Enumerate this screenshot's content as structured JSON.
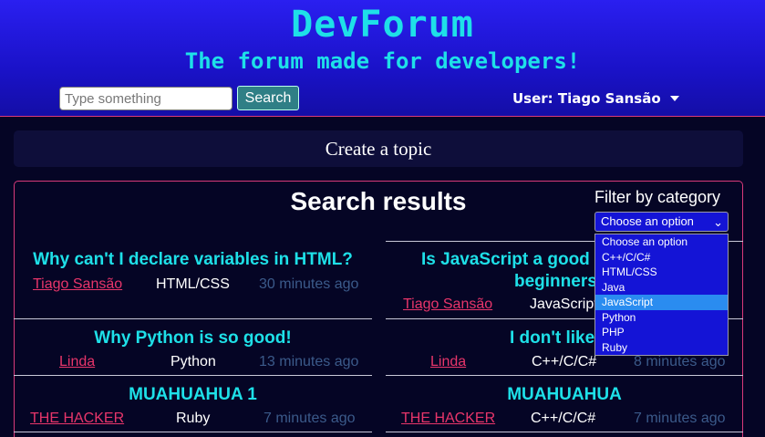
{
  "header": {
    "title": "DevForum",
    "subtitle": "The forum made for developers!",
    "search_placeholder": "Type something",
    "search_label": "Search",
    "user_label": "User: Tiago Sansão"
  },
  "create_topic_label": "Create a topic",
  "results": {
    "title": "Search results",
    "filter_label": "Filter by category",
    "filter_selected": "Choose an option",
    "filter_options": [
      "Choose an option",
      "C++/C/C#",
      "HTML/CSS",
      "Java",
      "JavaScript",
      "Python",
      "PHP",
      "Ruby"
    ],
    "filter_highlighted": "JavaScript"
  },
  "topics": [
    {
      "title": "Why can't I declare variables in HTML?",
      "author": "Tiago Sansão",
      "category": "HTML/CSS",
      "time": "30 minutes ago"
    },
    {
      "title": "Is JavaScript a good",
      "title2": "beginners",
      "author": "Tiago Sansão",
      "category": "JavaScript"
    },
    {
      "title": "Why Python is so good!",
      "author": "Linda",
      "category": "Python",
      "time": "13 minutes ago"
    },
    {
      "title": "I don't like",
      "author": "Linda",
      "category": "C++/C/C#",
      "time": "8 minutes ago"
    },
    {
      "title": "MUAHUAHUA 1",
      "author": "THE HACKER",
      "category": "Ruby",
      "time": "7 minutes ago"
    },
    {
      "title": "MUAHUAHUA",
      "author": "THE HACKER",
      "category": "C++/C/C#",
      "time": "7 minutes ago"
    }
  ],
  "colors": {
    "header_bg": "#1a12c8",
    "brand": "#1ee0e8",
    "accent_border": "#d93a7a",
    "author_link": "#e8356a",
    "time_text": "#3b5a8a",
    "page_bg": "#050525"
  }
}
